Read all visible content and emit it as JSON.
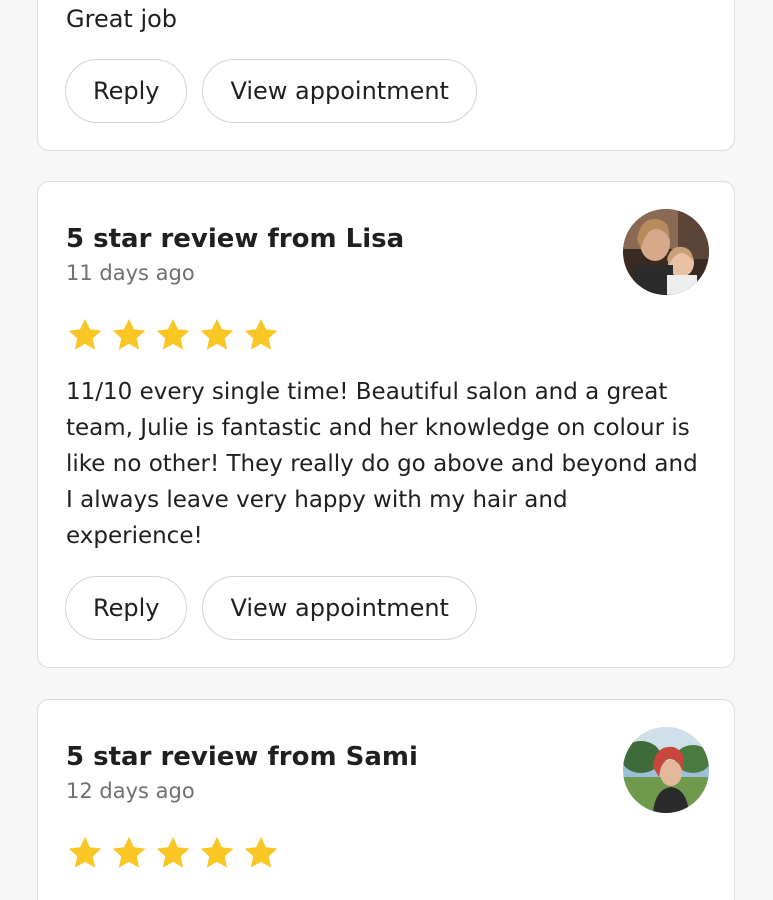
{
  "reviews": [
    {
      "text": "Great job",
      "reply_label": "Reply",
      "view_label": "View appointment"
    },
    {
      "title": "5 star review from Lisa",
      "time": "11 days ago",
      "rating": 5,
      "text": "11/10 every single time! Beautiful salon and a great team, Julie is fantastic and her knowledge on colour is like no other! They really do go above and beyond and I always leave very happy with my hair and experience!",
      "reply_label": "Reply",
      "view_label": "View appointment"
    },
    {
      "title": "5 star review from Sami",
      "time": "12 days ago",
      "rating": 5
    }
  ],
  "colors": {
    "star": "#f9c623",
    "card_border": "#dcdcdc",
    "muted_text": "#707070",
    "background": "#f7f7f7"
  },
  "icons": {
    "star": "star-icon",
    "avatar": "avatar-photo"
  }
}
